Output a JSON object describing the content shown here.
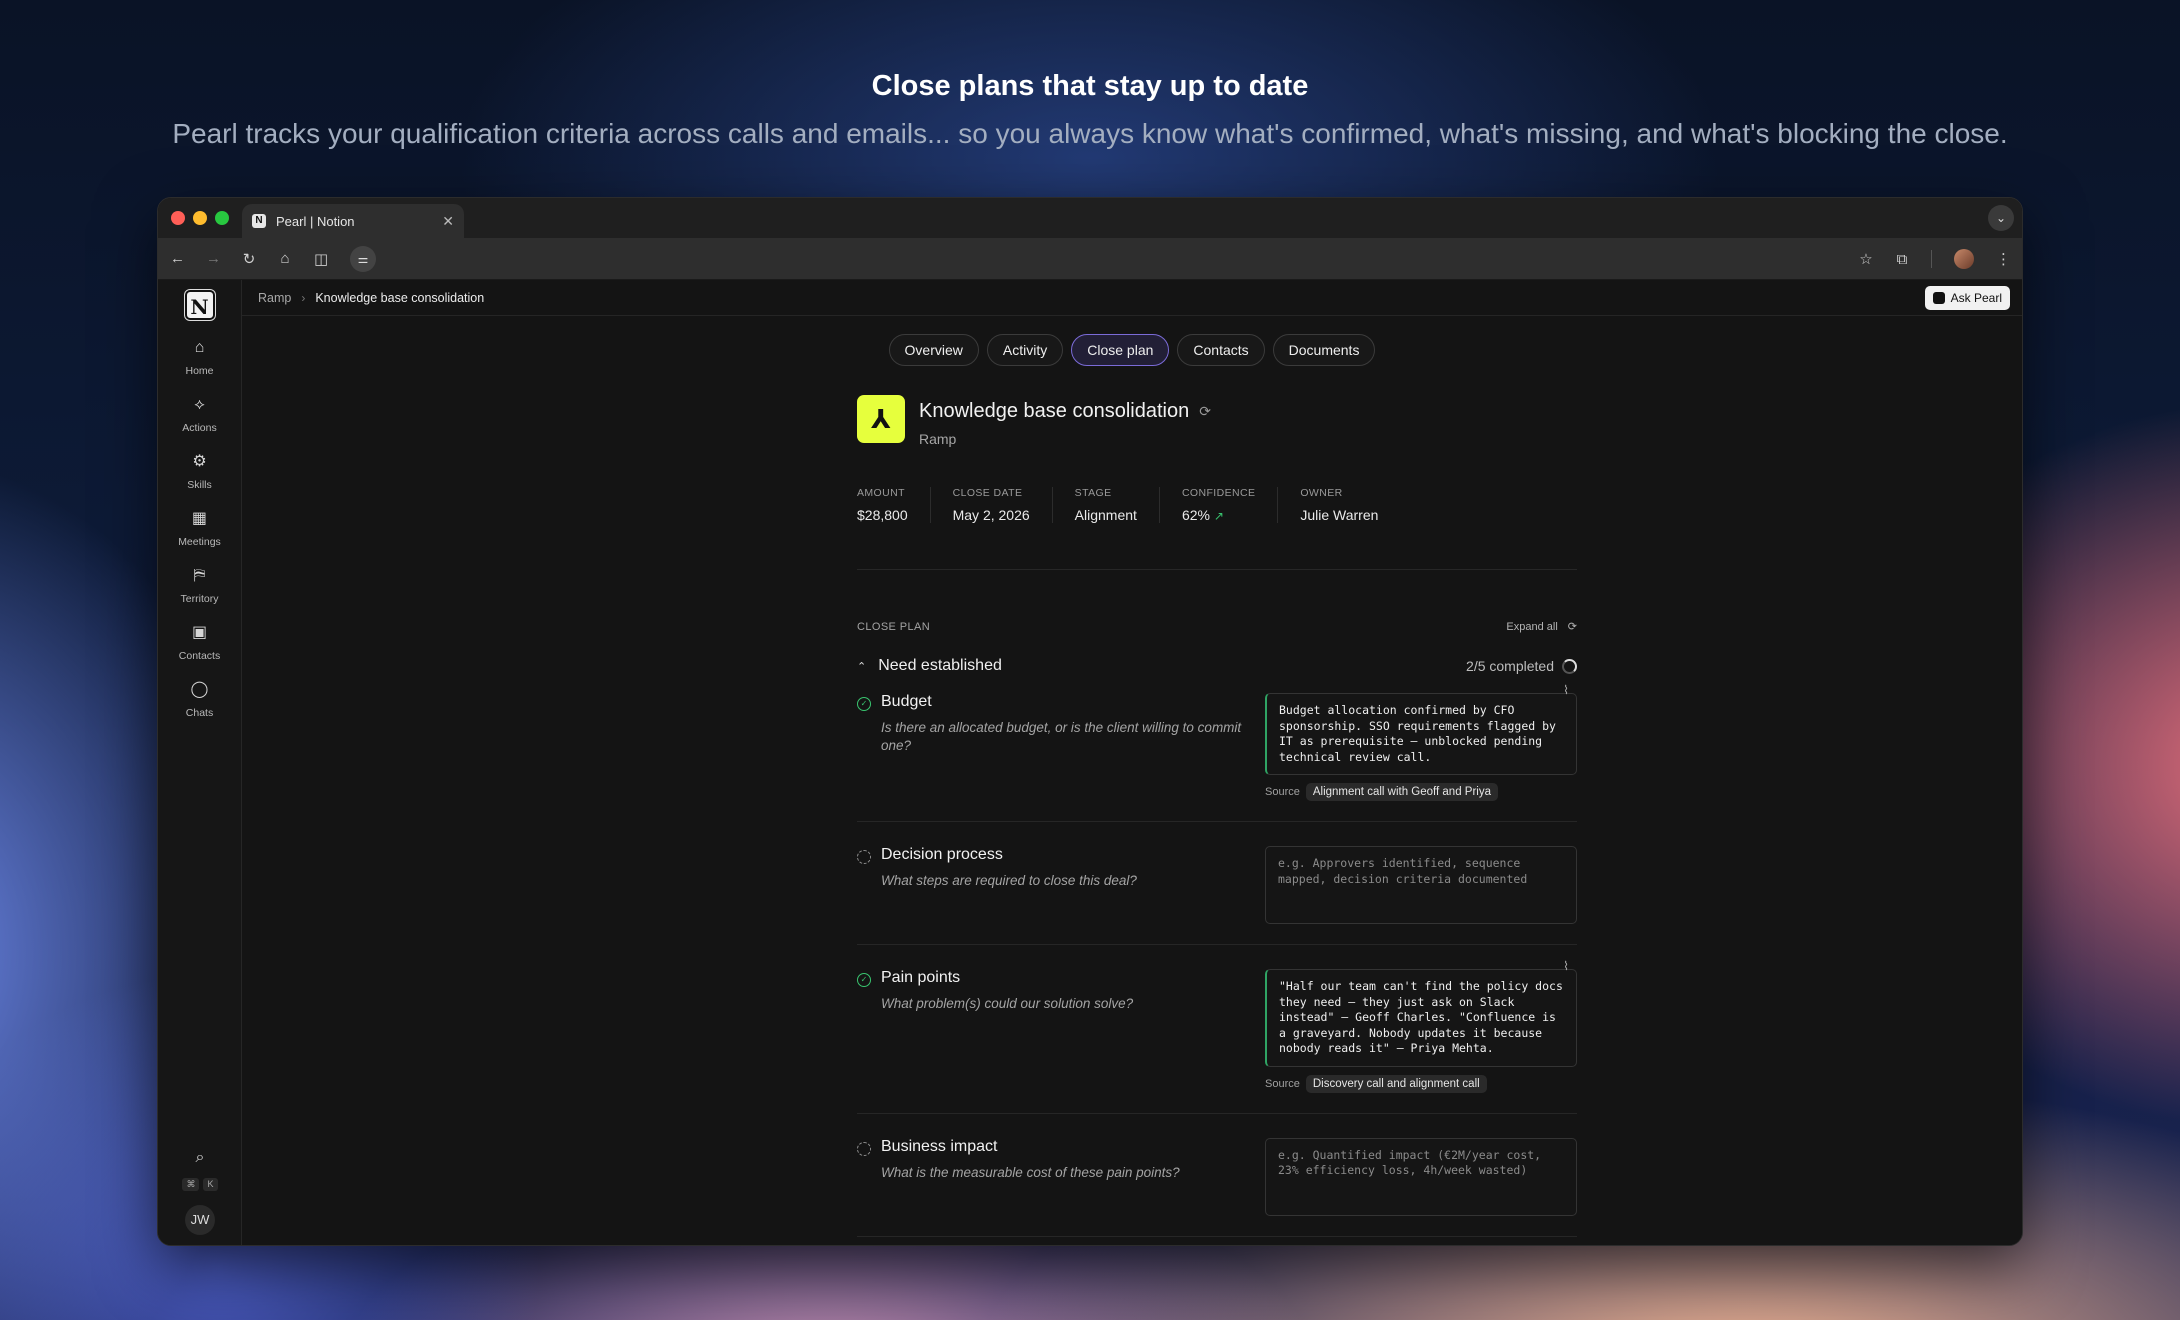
{
  "hero": {
    "title": "Close plans that stay up to date",
    "subtitle": "Pearl tracks your qualification criteria across calls and emails... so you always know what's confirmed, what's missing, and what's blocking the close."
  },
  "browser": {
    "tab_title": "Pearl | Notion",
    "tab_close": "✕",
    "tab_dropdown": "⌄"
  },
  "sidebar": {
    "logo": "N",
    "items": [
      {
        "label": "Home",
        "icon": "⌂"
      },
      {
        "label": "Actions",
        "icon": "⟡"
      },
      {
        "label": "Skills",
        "icon": "⚙"
      },
      {
        "label": "Meetings",
        "icon": "▦"
      },
      {
        "label": "Territory",
        "icon": "⛿"
      },
      {
        "label": "Contacts",
        "icon": "▣"
      },
      {
        "label": "Chats",
        "icon": "◯"
      }
    ],
    "search_icon": "⌕",
    "shortcut": [
      "⌘",
      "K"
    ],
    "avatar_initials": "JW"
  },
  "topbar": {
    "breadcrumb": [
      "Ramp",
      "Knowledge base consolidation"
    ],
    "ask_label": "Ask Pearl"
  },
  "tabs": [
    "Overview",
    "Activity",
    "Close plan",
    "Contacts",
    "Documents"
  ],
  "active_tab": "Close plan",
  "deal": {
    "title": "Knowledge base consolidation",
    "company": "Ramp",
    "logo_glyph": "⅄",
    "logo_color": "#e6ff3d",
    "metrics": [
      {
        "label": "AMOUNT",
        "value": "$28,800"
      },
      {
        "label": "CLOSE DATE",
        "value": "May 2, 2026"
      },
      {
        "label": "STAGE",
        "value": "Alignment"
      },
      {
        "label": "CONFIDENCE",
        "value": "62%"
      },
      {
        "label": "OWNER",
        "value": "Julie Warren"
      }
    ]
  },
  "close_plan": {
    "label": "CLOSE PLAN",
    "expand_label": "Expand all",
    "section_title": "Need established",
    "completed": "2/5 completed",
    "items": [
      {
        "title": "Budget",
        "question": "Is there an allocated budget, or is the client willing to commit one?",
        "status": "done",
        "note": "Budget allocation confirmed by CFO sponsorship. SSO requirements flagged by IT as prerequisite — unblocked pending technical review call.",
        "source_label": "Source",
        "source": "Alignment call with Geoff and Priya"
      },
      {
        "title": "Decision process",
        "question": "What steps are required to close this deal?",
        "status": "pending",
        "placeholder": "e.g. Approvers identified, sequence mapped, decision criteria documented"
      },
      {
        "title": "Pain points",
        "question": "What problem(s) could our solution solve?",
        "status": "done",
        "note": "\"Half our team can't find the policy docs they need — they just ask on Slack instead\" — Geoff Charles. \"Confluence is a graveyard. Nobody updates it because nobody reads it\" — Priya Mehta.",
        "source_label": "Source",
        "source": "Discovery call and alignment call"
      },
      {
        "title": "Business impact",
        "question": "What is the measurable cost of these pain points?",
        "status": "pending",
        "placeholder": "e.g. Quantified impact (€2M/year cost, 23% efficiency loss, 4h/week wasted)"
      }
    ]
  },
  "colors": {
    "accent_active_tab": "#7b6bd8",
    "success": "#39c46f",
    "window_bg": "#141414"
  }
}
